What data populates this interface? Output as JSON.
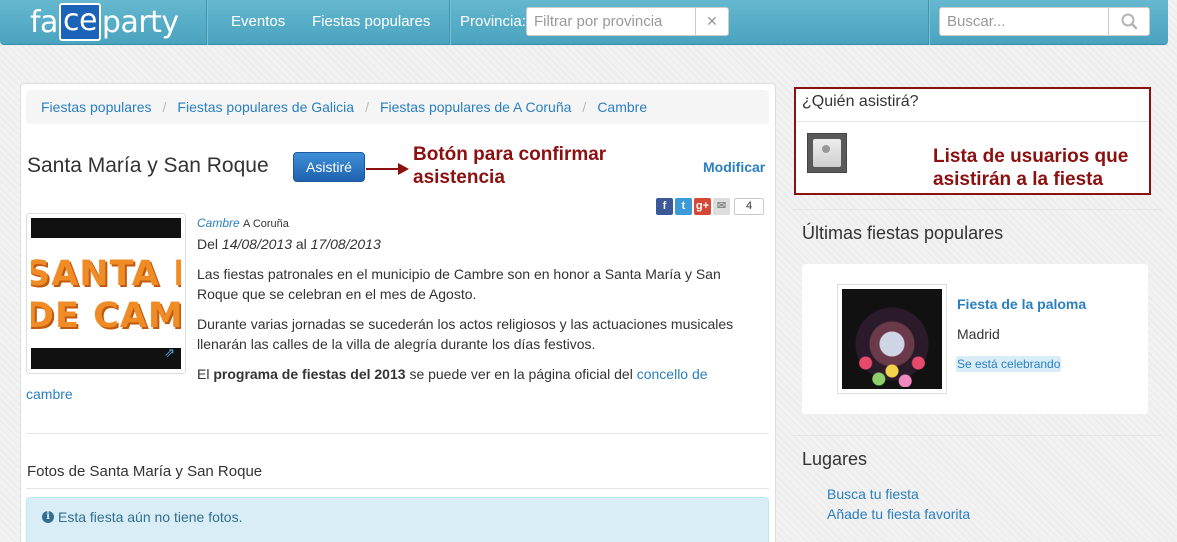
{
  "header": {
    "logo": {
      "pre": "fa",
      "highlight": "ce",
      "post": "party"
    },
    "nav": [
      "Eventos",
      "Fiestas populares"
    ],
    "provincia_label": "Provincia:",
    "provincia_placeholder": "Filtrar por provincia",
    "clear_glyph": "✕",
    "search_placeholder": "Buscar..."
  },
  "breadcrumb": [
    "Fiestas populares",
    "Fiestas populares de Galicia",
    "Fiestas populares de A Coruña",
    "Cambre"
  ],
  "event": {
    "title": "Santa María y San Roque",
    "attend_label": "Asistiré",
    "modify_label": "Modificar",
    "share_count": "4",
    "image_text": [
      "SANTA MA",
      "DE CAMBR"
    ],
    "location_link": "Cambre",
    "location_region": "A Coruña",
    "date_prefix": "Del",
    "date_start": "14/08/2013",
    "date_mid": "al",
    "date_end": "17/08/2013",
    "desc1": "Las fiestas patronales en el municipio de Cambre son en honor a Santa María y San Roque que se celebran en el mes de Agosto.",
    "desc2": "Durante varias jornadas se sucederán los actos religiosos y las actuaciones musicales llenarán las calles de la villa de alegría durante los días festivos.",
    "prog_pre": "El",
    "prog_bold": "programa de fiestas del 2013",
    "prog_mid": "se puede ver en la página oficial del",
    "prog_link": "concello de cambre"
  },
  "annotations": {
    "button_note_1": "Botón para confirmar",
    "button_note_2": "asistencia",
    "list_note_1": "Lista de usuarios que",
    "list_note_2": "asistirán a la fiesta"
  },
  "photos": {
    "title": "Fotos de Santa María y San Roque",
    "empty_icon": "i",
    "empty_text": "Esta fiesta aún no tiene fotos."
  },
  "sidebar": {
    "who_title": "¿Quién asistirá?",
    "latest_title": "Últimas fiestas populares",
    "latest": {
      "title": "Fiesta de la paloma",
      "city": "Madrid",
      "status": "Se está celebrando"
    },
    "places_title": "Lugares",
    "places_links": [
      "Busca tu fiesta",
      "Añade tu fiesta favorita"
    ]
  },
  "colors": {
    "navbar": "#4aa3bf",
    "link": "#2a7fc0",
    "annotation": "#8b1010",
    "primary_button": "#1f62b0"
  },
  "icons": [
    "search-icon",
    "clear-icon",
    "facebook-icon",
    "twitter-icon",
    "google-plus-icon",
    "email-icon",
    "external-link-icon",
    "info-icon",
    "user-avatar-icon"
  ]
}
